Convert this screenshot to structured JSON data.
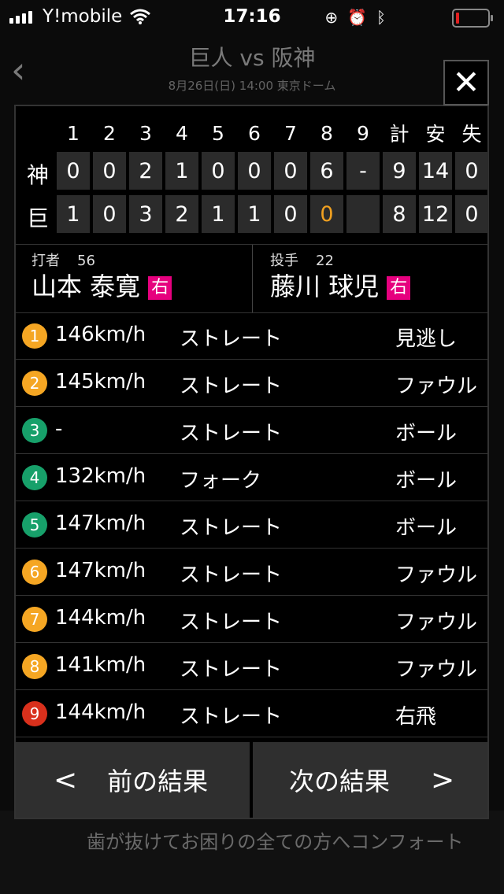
{
  "status_bar": {
    "carrier": "Y!mobile",
    "time": "17:16"
  },
  "background": {
    "title": "巨人 vs 阪神",
    "subtitle": "8月26日(日) 14:00 東京ドーム",
    "ad_text": "歯が抜けてお困りの全ての方へコンフォート"
  },
  "scoreboard": {
    "innings": [
      "1",
      "2",
      "3",
      "4",
      "5",
      "6",
      "7",
      "8",
      "9"
    ],
    "totals_headers": [
      "計",
      "安",
      "失"
    ],
    "teams": [
      {
        "name": "神",
        "scores": [
          "0",
          "0",
          "2",
          "1",
          "0",
          "0",
          "0",
          "6",
          "-"
        ],
        "totals": [
          "9",
          "14",
          "0"
        ]
      },
      {
        "name": "巨",
        "scores": [
          "1",
          "0",
          "3",
          "2",
          "1",
          "1",
          "0",
          "0",
          ""
        ],
        "totals": [
          "8",
          "12",
          "0"
        ]
      }
    ]
  },
  "batter": {
    "role": "打者",
    "number": "56",
    "name": "山本 泰寛",
    "hand": "右"
  },
  "pitcher": {
    "role": "投手",
    "number": "22",
    "name": "藤川 球児",
    "hand": "右"
  },
  "pitches": [
    {
      "num": "1",
      "speed": "146km/h",
      "type": "ストレート",
      "result": "見逃し",
      "color": "#f5a623"
    },
    {
      "num": "2",
      "speed": "145km/h",
      "type": "ストレート",
      "result": "ファウル",
      "color": "#f5a623"
    },
    {
      "num": "3",
      "speed": "-",
      "type": "ストレート",
      "result": "ボール",
      "color": "#17a06a"
    },
    {
      "num": "4",
      "speed": "132km/h",
      "type": "フォーク",
      "result": "ボール",
      "color": "#17a06a"
    },
    {
      "num": "5",
      "speed": "147km/h",
      "type": "ストレート",
      "result": "ボール",
      "color": "#17a06a"
    },
    {
      "num": "6",
      "speed": "147km/h",
      "type": "ストレート",
      "result": "ファウル",
      "color": "#f5a623"
    },
    {
      "num": "7",
      "speed": "144km/h",
      "type": "ストレート",
      "result": "ファウル",
      "color": "#f5a623"
    },
    {
      "num": "8",
      "speed": "141km/h",
      "type": "ストレート",
      "result": "ファウル",
      "color": "#f5a623"
    },
    {
      "num": "9",
      "speed": "144km/h",
      "type": "ストレート",
      "result": "右飛",
      "color": "#d9301c"
    }
  ],
  "nav": {
    "prev_label": "前の結果",
    "prev_chevron": "<",
    "next_label": "次の結果",
    "next_chevron": ">"
  }
}
